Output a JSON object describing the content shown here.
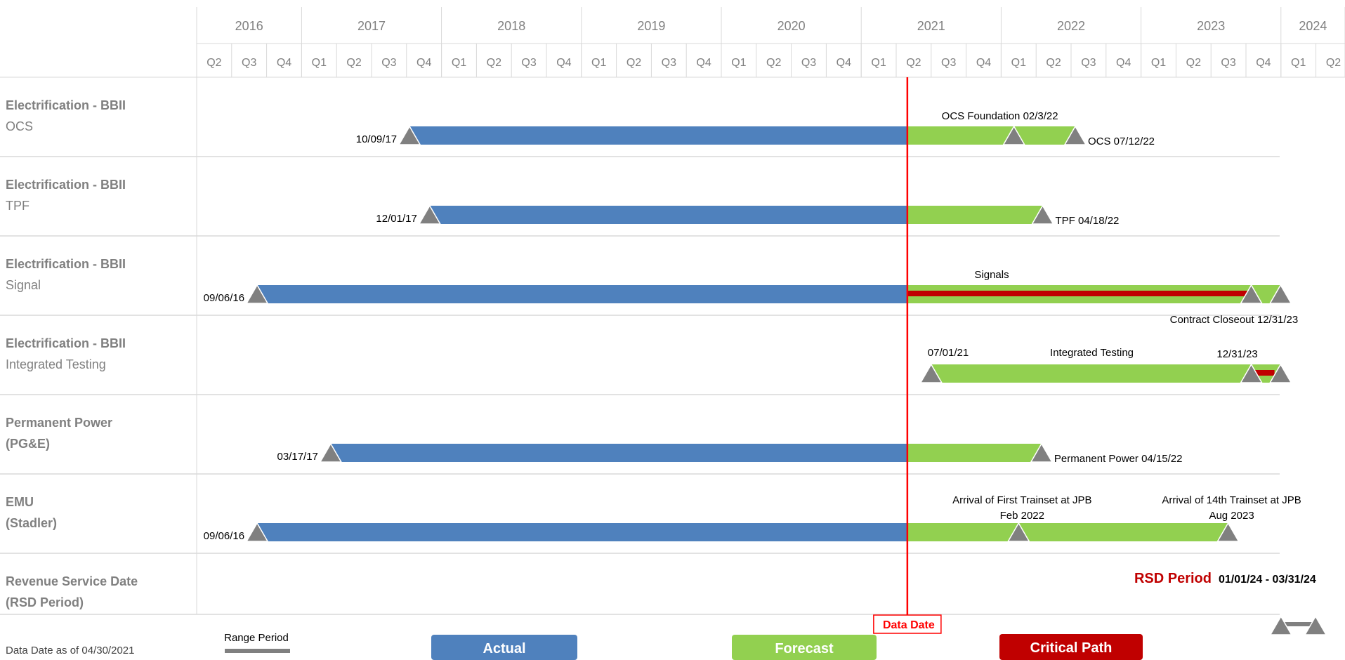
{
  "chart_data": {
    "type": "gantt",
    "years": [
      "2016",
      "2017",
      "2018",
      "2019",
      "2020",
      "2021",
      "2022",
      "2023",
      "2024"
    ],
    "quarters": [
      "Q2",
      "Q3",
      "Q4",
      "Q1",
      "Q2",
      "Q3",
      "Q4",
      "Q1",
      "Q2",
      "Q3",
      "Q4",
      "Q1",
      "Q2",
      "Q3",
      "Q4",
      "Q1",
      "Q2",
      "Q3",
      "Q4",
      "Q1",
      "Q2",
      "Q3",
      "Q4",
      "Q1",
      "Q2",
      "Q3",
      "Q4",
      "Q1",
      "Q2",
      "Q3",
      "Q4",
      "Q1",
      "Q2"
    ],
    "data_date": "2021-04-30",
    "rows": [
      {
        "title": "Electrification - BBII",
        "subtitle": "OCS",
        "bars": [
          {
            "kind": "actual",
            "start": "2017-10-09",
            "end": "2021-04-30"
          },
          {
            "kind": "forecast",
            "start": "2021-04-30",
            "end": "2022-07-12"
          }
        ],
        "milestones": [
          {
            "date": "2017-10-09",
            "label": "10/09/17",
            "pos": "left"
          },
          {
            "date": "2022-02-03",
            "label": "OCS Foundation 02/3/22",
            "pos": "above"
          },
          {
            "date": "2022-07-12",
            "label": "OCS 07/12/22",
            "pos": "right"
          }
        ]
      },
      {
        "title": "Electrification - BBII",
        "subtitle": "TPF",
        "bars": [
          {
            "kind": "actual",
            "start": "2017-12-01",
            "end": "2021-04-30"
          },
          {
            "kind": "forecast",
            "start": "2021-04-30",
            "end": "2022-04-18"
          }
        ],
        "milestones": [
          {
            "date": "2017-12-01",
            "label": "12/01/17",
            "pos": "left"
          },
          {
            "date": "2022-04-18",
            "label": "TPF 04/18/22",
            "pos": "right"
          }
        ]
      },
      {
        "title": "Electrification - BBII",
        "subtitle": "Signal",
        "bars": [
          {
            "kind": "actual",
            "start": "2016-09-06",
            "end": "2021-04-30"
          },
          {
            "kind": "forecast",
            "start": "2021-04-30",
            "end": "2023-12-31",
            "label": "Signals"
          },
          {
            "kind": "critical",
            "start": "2021-04-30",
            "end": "2023-10-15"
          }
        ],
        "milestones": [
          {
            "date": "2016-09-06",
            "label": "09/06/16",
            "pos": "left"
          },
          {
            "date": "2023-10-15",
            "label": "",
            "pos": "none"
          },
          {
            "date": "2023-12-31",
            "label": "Contract Closeout 12/31/23",
            "pos": "below-left"
          }
        ]
      },
      {
        "title": "Electrification - BBII",
        "subtitle": "Integrated Testing",
        "bars": [
          {
            "kind": "forecast",
            "start": "2021-07-01",
            "end": "2023-12-31",
            "label": "Integrated Testing"
          },
          {
            "kind": "critical",
            "start": "2023-10-15",
            "end": "2023-12-15"
          }
        ],
        "milestones": [
          {
            "date": "2021-07-01",
            "label": "07/01/21",
            "pos": "above-right"
          },
          {
            "date": "2023-10-15",
            "label": "12/31/23",
            "pos": "above"
          },
          {
            "date": "2023-12-31",
            "label": "",
            "pos": "none"
          }
        ]
      },
      {
        "title": "Permanent Power",
        "subtitle": "(PG&E)",
        "bars": [
          {
            "kind": "actual",
            "start": "2017-03-17",
            "end": "2021-04-30"
          },
          {
            "kind": "forecast",
            "start": "2021-04-30",
            "end": "2022-04-15"
          }
        ],
        "milestones": [
          {
            "date": "2017-03-17",
            "label": "03/17/17",
            "pos": "left"
          },
          {
            "date": "2022-04-15",
            "label": "Permanent Power 04/15/22",
            "pos": "right"
          }
        ]
      },
      {
        "title": "EMU",
        "subtitle": "(Stadler)",
        "bars": [
          {
            "kind": "actual",
            "start": "2016-09-06",
            "end": "2021-04-30"
          },
          {
            "kind": "forecast",
            "start": "2021-04-30",
            "end": "2023-08-15"
          }
        ],
        "milestones": [
          {
            "date": "2016-09-06",
            "label": "09/06/16",
            "pos": "left"
          },
          {
            "date": "2022-02-15",
            "label": "Arrival of First Trainset at JPB",
            "label2": "Feb 2022",
            "pos": "above2"
          },
          {
            "date": "2023-08-15",
            "label": "Arrival of 14th Trainset at JPB",
            "label2": "Aug 2023",
            "pos": "above2"
          }
        ]
      },
      {
        "title": "Revenue Service Date",
        "subtitle": "(RSD Period)",
        "rsd_label": "RSD Period",
        "rsd_range": "01/01/24 - 03/31/24",
        "bars": [
          {
            "kind": "range",
            "start": "2024-01-01",
            "end": "2024-03-31"
          }
        ],
        "milestones": [
          {
            "date": "2024-01-01",
            "label": "",
            "pos": "none"
          },
          {
            "date": "2024-03-31",
            "label": "",
            "pos": "none"
          }
        ]
      }
    ],
    "legend": {
      "range": "Range Period",
      "actual": "Actual",
      "forecast": "Forecast",
      "critical": "Critical Path",
      "data_date": "Data Date"
    },
    "footnote": "Data Date as of 04/30/2021",
    "colors": {
      "actual": "#4f81bd",
      "forecast": "#92d050",
      "critical": "#c00000",
      "milestone": "#808080",
      "data_date": "#ff0000",
      "grid": "#d9d9d9",
      "header_text": "#808080",
      "row_label": "#808080"
    }
  }
}
